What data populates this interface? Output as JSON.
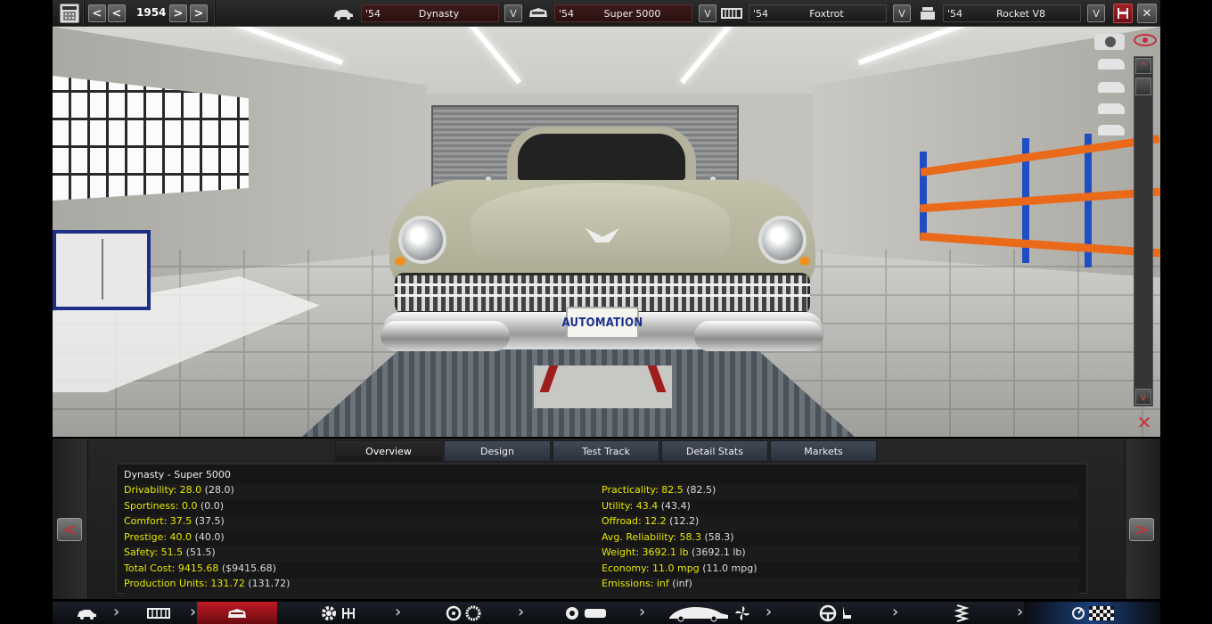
{
  "topbar": {
    "year": "1954",
    "prev_fast": "<",
    "prev": "<",
    "next": ">",
    "next_fast": ">",
    "dropdown_glyph": "V",
    "models": [
      {
        "year": "'54",
        "name": "Dynasty",
        "icon": "car-model-icon"
      },
      {
        "year": "'54",
        "name": "Super 5000",
        "icon": "trim-icon"
      },
      {
        "year": "'54",
        "name": "Foxtrot",
        "icon": "chassis-icon"
      },
      {
        "year": "'54",
        "name": "Rocket V8",
        "icon": "engine-icon"
      }
    ],
    "save_icon": "save-icon",
    "close_glyph": "✕"
  },
  "scene": {
    "plate_text": "AUTOMATION",
    "scroll_up": "^",
    "scroll_down": "v",
    "close_glyph": "✕"
  },
  "tabs": [
    "Overview",
    "Design",
    "Test Track",
    "Detail Stats",
    "Markets"
  ],
  "active_tab": "Overview",
  "stats": {
    "title": "Dynasty - Super 5000",
    "left": [
      {
        "label": "Drivability: 28.0",
        "base": " (28.0)"
      },
      {
        "label": "Sportiness: 0.0",
        "base": " (0.0)"
      },
      {
        "label": "Comfort: 37.5",
        "base": " (37.5)"
      },
      {
        "label": "Prestige: 40.0",
        "base": " (40.0)"
      },
      {
        "label": "Safety: 51.5",
        "base": " (51.5)"
      },
      {
        "label": "Total Cost: 9415.68",
        "base": " ($9415.68)"
      },
      {
        "label": "Production Units: 131.72",
        "base": " (131.72)"
      }
    ],
    "right": [
      {
        "label": "Practicality: 82.5",
        "base": " (82.5)"
      },
      {
        "label": "Utility: 43.4",
        "base": " (43.4)"
      },
      {
        "label": "Offroad: 12.2",
        "base": " (12.2)"
      },
      {
        "label": "Avg. Reliability: 58.3",
        "base": " (58.3)"
      },
      {
        "label": "Weight: 3692.1 lb",
        "base": " (3692.1 lb)"
      },
      {
        "label": "Economy: 11.0 mpg",
        "base": " (11.0 mpg)"
      },
      {
        "label": "Emissions: inf",
        "base": " (inf)"
      }
    ]
  },
  "nav_arrows": {
    "left": "<",
    "right": ">"
  },
  "bottom_nav": [
    {
      "name": "car-model-nav",
      "icon": "car-icon"
    },
    {
      "name": "chassis-nav",
      "icon": "chassis-icon"
    },
    {
      "name": "body-nav",
      "icon": "body-icon"
    },
    {
      "name": "engine-gearbox-nav",
      "icon": "gear-icon"
    },
    {
      "name": "wheels-nav",
      "icon": "wheel-icon"
    },
    {
      "name": "brakes-nav",
      "icon": "brake-icon"
    },
    {
      "name": "aero-cooling-nav",
      "icon": "fan-icon"
    },
    {
      "name": "interior-nav",
      "icon": "steering-wheel-icon"
    },
    {
      "name": "suspension-nav",
      "icon": "spring-icon"
    },
    {
      "name": "finish-nav",
      "icon": "checkered-flag-icon"
    }
  ],
  "colors": {
    "accent_red": "#c4323a",
    "stat_yellow": "#e6e600",
    "tab_blue": "#424a58"
  }
}
